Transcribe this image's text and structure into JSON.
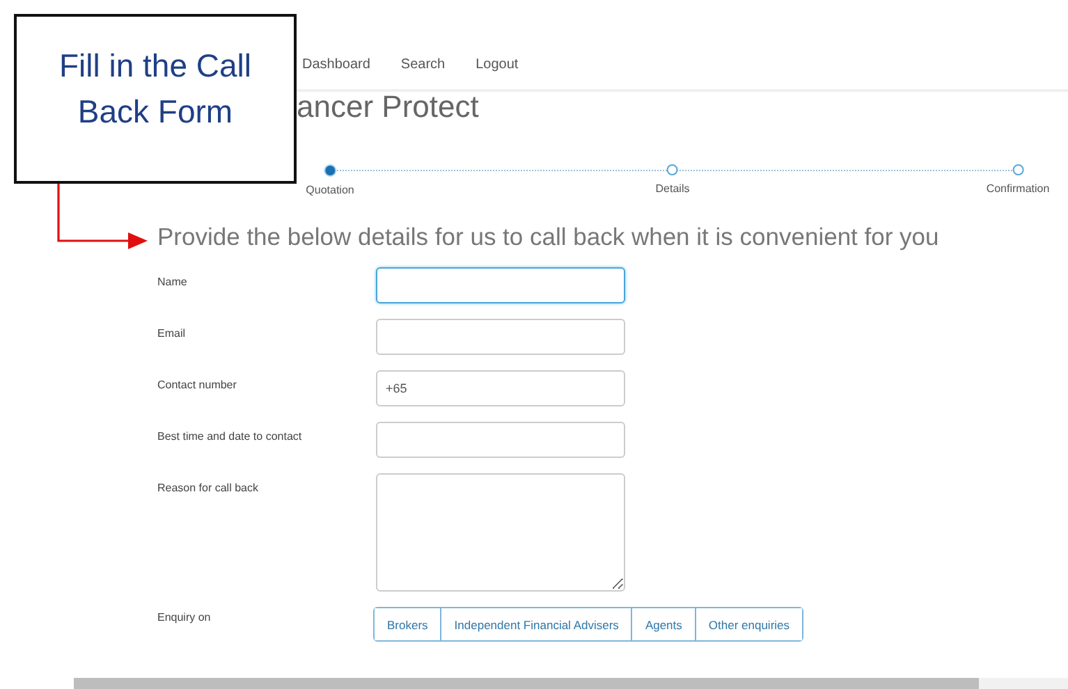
{
  "nav": {
    "links": [
      "Dashboard",
      "Search",
      "Logout"
    ]
  },
  "page_title": "ancer Protect",
  "steps": [
    {
      "label": "Quotation",
      "selected": true
    },
    {
      "label": "Details",
      "selected": false
    },
    {
      "label": "Confirmation",
      "selected": false
    }
  ],
  "heading": "Provide the below details for us to call back when it is convenient for you",
  "fields": [
    {
      "label": "Name",
      "kind": "input",
      "focused": true
    },
    {
      "label": "Email",
      "kind": "input",
      "focused": false
    },
    {
      "label": "Contact number",
      "kind": "input",
      "value": "+65",
      "focused": false
    },
    {
      "label": "Best time and date to contact",
      "kind": "input",
      "focused": false
    },
    {
      "label": "Reason for call back",
      "kind": "textarea",
      "focused": false
    }
  ],
  "enquiry": {
    "label": "Enquiry on",
    "options": [
      "Brokers",
      "Independent Financial Advisers",
      "Agents",
      "Other enquiries"
    ]
  },
  "callout": {
    "text": "Fill in the Call Back Form"
  }
}
